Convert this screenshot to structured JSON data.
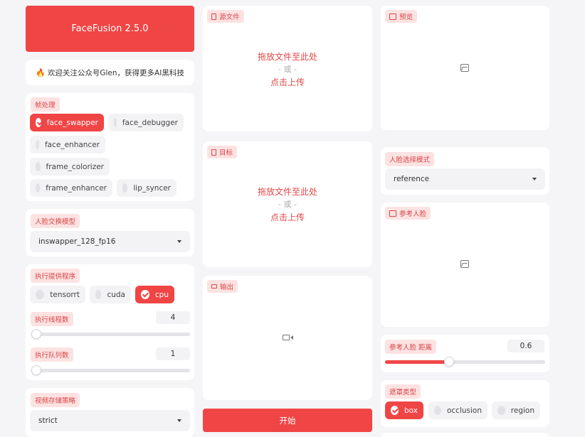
{
  "app": {
    "title": "FaceFusion 2.5.0",
    "notice": "欢迎关注公众号Glen，获得更多AI黑科技"
  },
  "frame_processors": {
    "label": "帧处理",
    "options": [
      {
        "label": "face_swapper",
        "checked": true
      },
      {
        "label": "face_debugger",
        "checked": false
      },
      {
        "label": "face_enhancer",
        "checked": false
      },
      {
        "label": "frame_colorizer",
        "checked": false
      },
      {
        "label": "frame_enhancer",
        "checked": false
      },
      {
        "label": "lip_syncer",
        "checked": false
      }
    ]
  },
  "face_swapper_model": {
    "label": "人脸交换模型",
    "value": "inswapper_128_fp16"
  },
  "execution": {
    "label": "执行提供程序",
    "providers": [
      {
        "label": "tensorrt",
        "checked": false
      },
      {
        "label": "cuda",
        "checked": false
      },
      {
        "label": "cpu",
        "checked": true
      }
    ],
    "thread_count": {
      "label": "执行线程数",
      "value": "4",
      "fraction": 0.03
    },
    "queue_count": {
      "label": "执行队列数",
      "value": "1",
      "fraction": 0.0
    }
  },
  "video_memory_strategy": {
    "label": "视频存储策略",
    "value": "strict"
  },
  "source": {
    "label": "源文件",
    "drop": "拖放文件至此处",
    "or": "- 或 -",
    "click": "点击上传"
  },
  "target": {
    "label": "目标",
    "drop": "拖放文件至此处",
    "or": "- 或 -",
    "click": "点击上传"
  },
  "output": {
    "label": "输出"
  },
  "start": {
    "label": "开始"
  },
  "preview": {
    "label": "预览"
  },
  "face_selector_mode": {
    "label": "人脸选择模式",
    "value": "reference"
  },
  "reference_face": {
    "label": "参考人脸"
  },
  "reference_face_distance": {
    "label": "参考人脸 距离",
    "value": "0.6",
    "fraction": 0.4
  },
  "face_mask_types": {
    "label": "遮罩类型",
    "options": [
      {
        "label": "box",
        "checked": true
      },
      {
        "label": "occlusion",
        "checked": false
      },
      {
        "label": "region",
        "checked": false
      }
    ]
  },
  "colors": {
    "accent": "#f04545",
    "tag_bg": "#fde2e2",
    "tag_text": "#d94545"
  }
}
